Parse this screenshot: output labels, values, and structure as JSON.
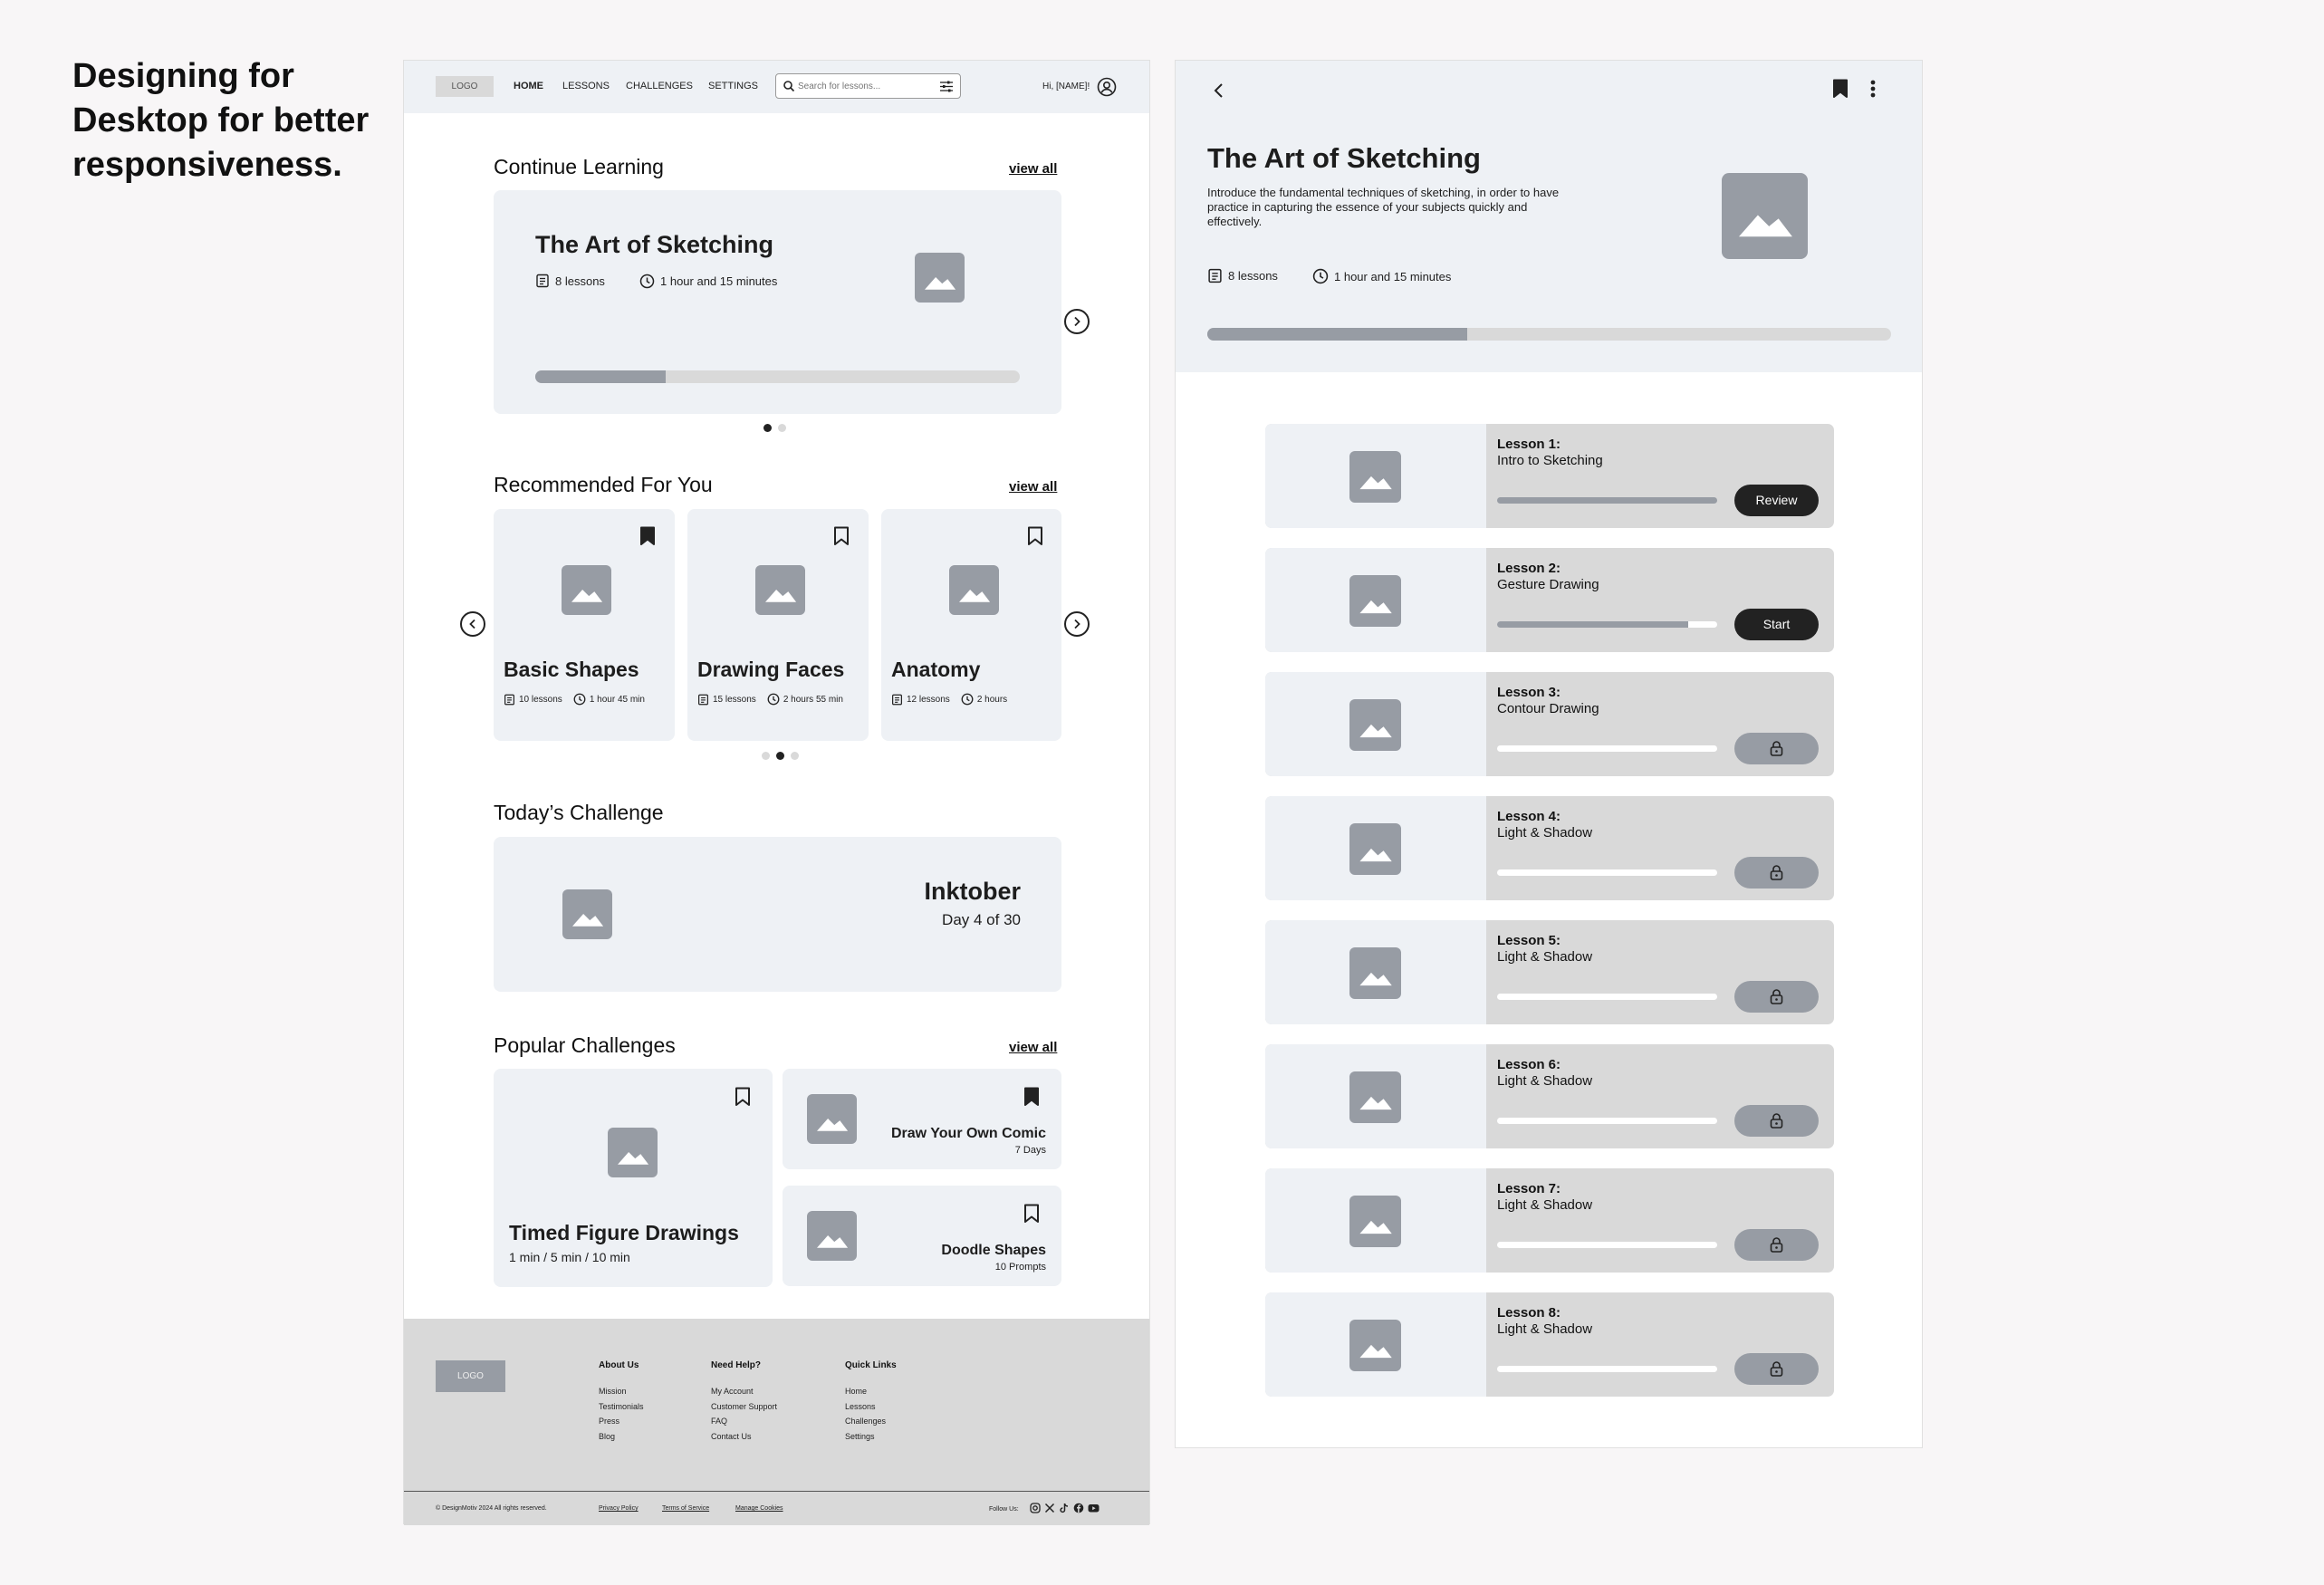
{
  "headline": "Designing for Desktop for better responsiveness.",
  "colors": {
    "accent_dark": "#222222",
    "placeholder": "#979ca4",
    "card_bg": "#eef1f5",
    "track": "#d9d9d9"
  },
  "desktop": {
    "nav": {
      "logo": "LOGO",
      "links": [
        "HOME",
        "LESSONS",
        "CHALLENGES",
        "SETTINGS"
      ],
      "active": "HOME",
      "search_placeholder": "Search for lessons...",
      "greeting": "Hi, [NAME]!"
    },
    "continue": {
      "title": "Continue Learning",
      "view_all": "view all",
      "card": {
        "title": "The Art of Sketching",
        "lessons": "8 lessons",
        "duration": "1 hour and 15 minutes",
        "progress": 0.27
      },
      "page_count": 2,
      "page_active": 0
    },
    "recommended": {
      "title": "Recommended For You",
      "view_all": "view all",
      "cards": [
        {
          "title": "Basic Shapes",
          "lessons": "10 lessons",
          "duration": "1 hour 45 min",
          "bookmarked": true
        },
        {
          "title": "Drawing Faces",
          "lessons": "15 lessons",
          "duration": "2 hours 55 min",
          "bookmarked": false
        },
        {
          "title": "Anatomy",
          "lessons": "12 lessons",
          "duration": "2 hours",
          "bookmarked": false
        }
      ],
      "page_count": 3,
      "page_active": 1
    },
    "today": {
      "title": "Today’s Challenge",
      "name": "Inktober",
      "subtitle": "Day 4 of 30"
    },
    "popular": {
      "title": "Popular Challenges",
      "view_all": "view all",
      "big": {
        "title": "Timed Figure Drawings",
        "subtitle": "1 min / 5 min / 10 min",
        "bookmarked": false
      },
      "small": [
        {
          "title": "Draw Your Own Comic",
          "subtitle": "7 Days",
          "bookmarked": true
        },
        {
          "title": "Doodle Shapes",
          "subtitle": "10 Prompts",
          "bookmarked": false
        }
      ]
    },
    "footer": {
      "logo": "LOGO",
      "columns": [
        {
          "heading": "About Us",
          "links": [
            "Mission",
            "Testimonials",
            "Press",
            "Blog"
          ]
        },
        {
          "heading": "Need Help?",
          "links": [
            "My Account",
            "Customer Support",
            "FAQ",
            "Contact Us"
          ]
        },
        {
          "heading": "Quick Links",
          "links": [
            "Home",
            "Lessons",
            "Challenges",
            "Settings"
          ]
        }
      ],
      "copyright": "© DesignMotiv 2024 All rights reserved.",
      "legal": [
        "Privacy Policy",
        "Terms of Service",
        "Manage Cookies"
      ],
      "follow": "Follow Us:"
    }
  },
  "course": {
    "title": "The Art of Sketching",
    "description": "Introduce the fundamental techniques of sketching, in order to have practice in capturing the essence of your subjects quickly and effectively.",
    "lessons_count": "8 lessons",
    "duration": "1 hour and 15 minutes",
    "progress": 0.38,
    "lessons": [
      {
        "number": "Lesson 1:",
        "name": "Intro to Sketching",
        "progress": 1.0,
        "action": "Review"
      },
      {
        "number": "Lesson 2:",
        "name": "Gesture Drawing",
        "progress": 0.87,
        "action": "Start"
      },
      {
        "number": "Lesson 3:",
        "name": "Contour Drawing",
        "progress": 0,
        "action": "locked"
      },
      {
        "number": "Lesson 4:",
        "name": "Light & Shadow",
        "progress": 0,
        "action": "locked"
      },
      {
        "number": "Lesson 5:",
        "name": "Light & Shadow",
        "progress": 0,
        "action": "locked"
      },
      {
        "number": "Lesson 6:",
        "name": "Light & Shadow",
        "progress": 0,
        "action": "locked"
      },
      {
        "number": "Lesson 7:",
        "name": "Light & Shadow",
        "progress": 0,
        "action": "locked"
      },
      {
        "number": "Lesson 8:",
        "name": "Light & Shadow",
        "progress": 0,
        "action": "locked"
      }
    ]
  }
}
